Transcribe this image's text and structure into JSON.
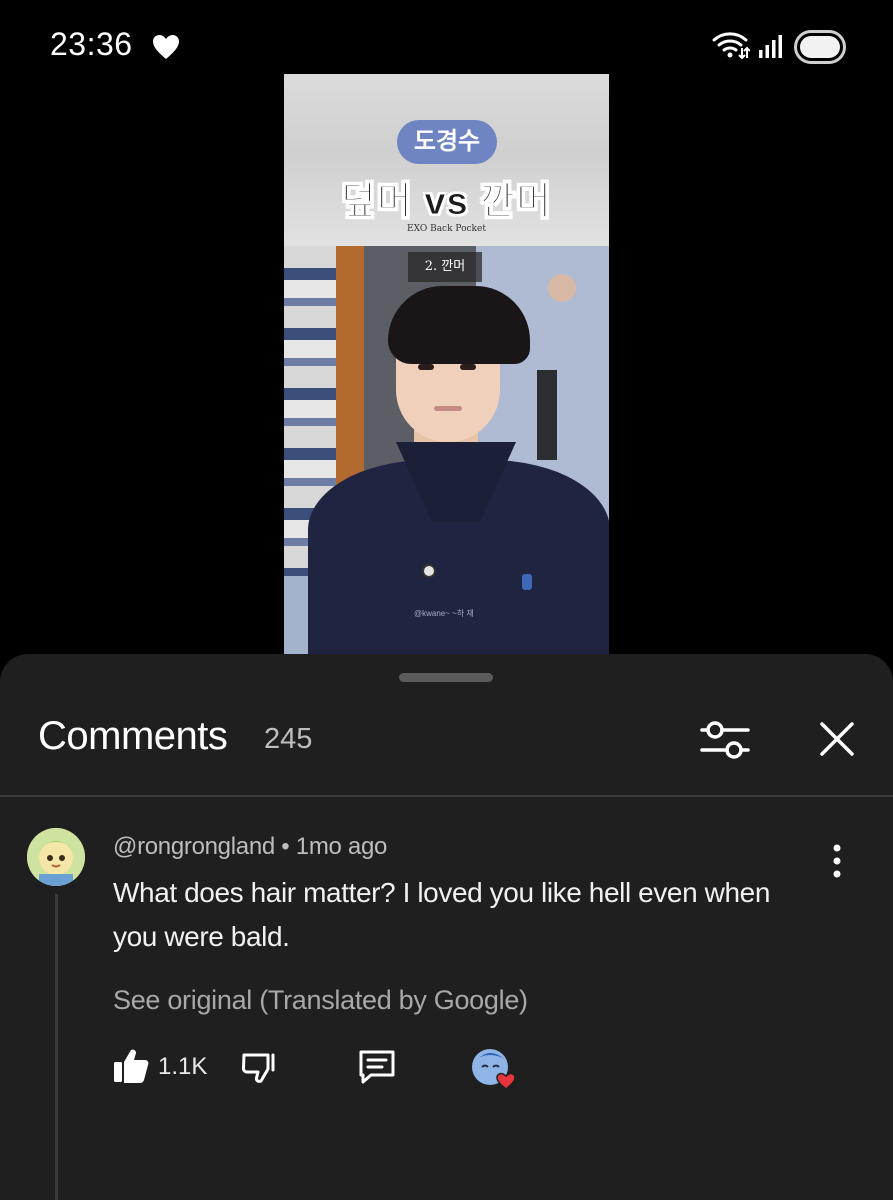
{
  "status_bar": {
    "time": "23:36",
    "icons": [
      "heart-icon",
      "wifi-icon",
      "signal-icon",
      "battery-icon"
    ]
  },
  "video": {
    "name_pill": "도경수",
    "title": "덮머 vs 깐머",
    "credit": "EXO Back Pocket",
    "chapter": "2. 깐머",
    "caption": "@kwane~ ~하 재"
  },
  "comments": {
    "title": "Comments",
    "count": "245",
    "icons": {
      "filter": "filter-icon",
      "close": "close-icon"
    },
    "items": [
      {
        "handle": "@rongrongland",
        "separator": "•",
        "time": "1mo ago",
        "text": "What does hair matter? I loved you like hell even when you were bald.",
        "see_original": "See original (Translated by Google)",
        "likes": "1.1K",
        "icons": [
          "thumbs-up-icon",
          "thumbs-down-icon",
          "reply-icon",
          "creator-heart-icon",
          "more-vert-icon"
        ]
      }
    ]
  },
  "colors": {
    "background": "#000000",
    "sheet": "#1f1f1f",
    "text_primary": "#f1f1f1",
    "text_secondary": "#bdbdbd",
    "heart_red": "#e8343c",
    "pill_blue": "#6f84c2"
  }
}
